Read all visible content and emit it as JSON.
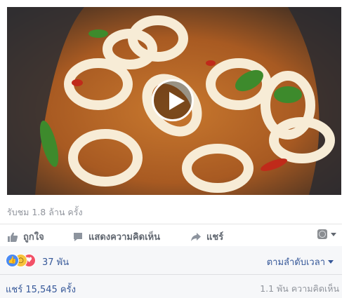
{
  "video": {
    "play_icon": "play-icon"
  },
  "views": {
    "label": "รับชม 1.8 ล้าน ครั้ง"
  },
  "actions": {
    "like": {
      "label": "ถูกใจ",
      "icon": "thumbs-up-icon"
    },
    "comment": {
      "label": "แสดงความคิดเห็น",
      "icon": "comment-icon"
    },
    "share": {
      "label": "แชร์",
      "icon": "share-arrow-icon"
    },
    "audience_icon": "globe-icon"
  },
  "reactions": {
    "icons": [
      "like-reaction-icon",
      "wow-reaction-icon",
      "love-reaction-icon"
    ],
    "count": "37 พัน",
    "sort_label": "ตามลำดับเวลา"
  },
  "footer": {
    "shares": "แชร์ 15,545 ครั้ง",
    "comments": "1.1 พัน ความคิดเห็น"
  },
  "colors": {
    "link": "#365899",
    "muted": "#90949c",
    "like": "#4a8af4",
    "wow": "#f7c33b",
    "love": "#f25268"
  }
}
